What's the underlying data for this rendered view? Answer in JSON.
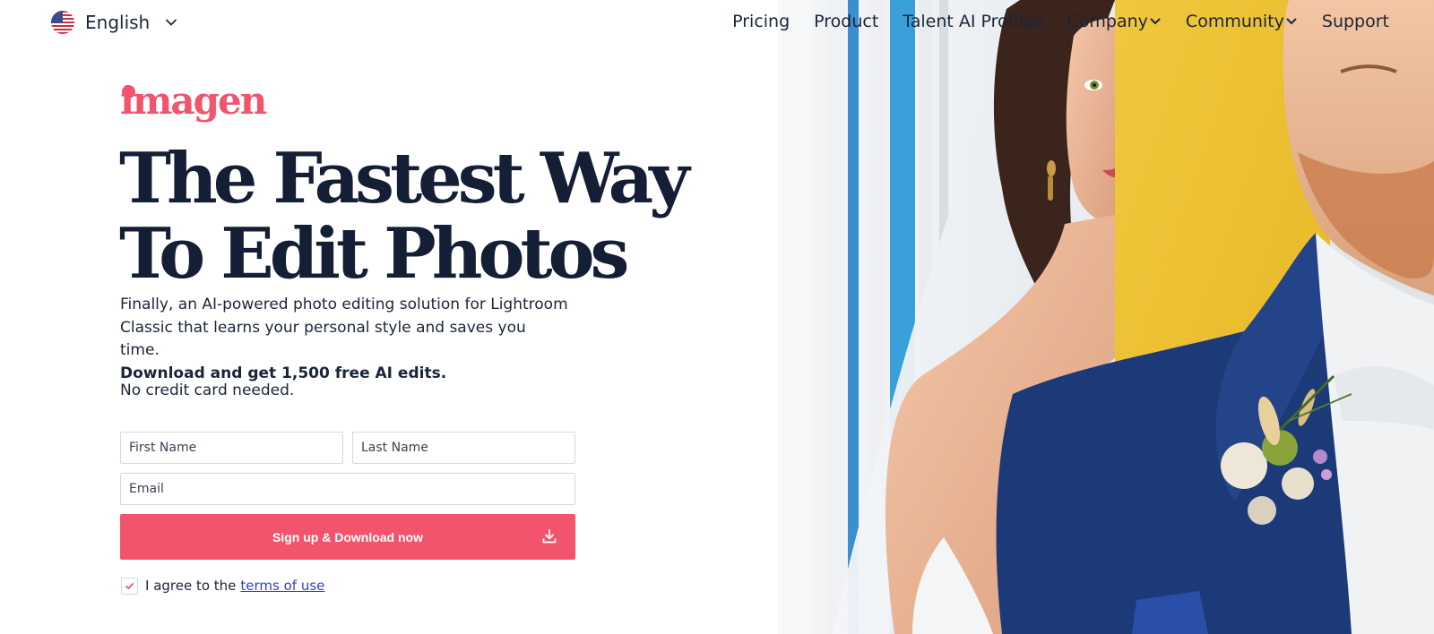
{
  "language": {
    "label": "English",
    "flag_icon": "us-flag-icon",
    "chevron_icon": "chevron-down-icon"
  },
  "nav": {
    "items": [
      {
        "label": "Pricing",
        "has_dropdown": false
      },
      {
        "label": "Product",
        "has_dropdown": false
      },
      {
        "label": "Talent AI Profiles",
        "has_dropdown": false
      },
      {
        "label": "Company",
        "has_dropdown": true
      },
      {
        "label": "Community",
        "has_dropdown": true
      },
      {
        "label": "Support",
        "has_dropdown": false
      }
    ]
  },
  "brand": {
    "logo_text": "imagen",
    "color": "#f2546d"
  },
  "hero": {
    "headline_line1": "The Fastest Way",
    "headline_line2": "To Edit Photos",
    "description": "Finally, an AI-powered photo editing solution for Lightroom Classic that learns your personal style and saves you time.",
    "description_strong": "Download and get 1,500 free AI edits.",
    "no_card": "No credit card needed."
  },
  "form": {
    "first_name_placeholder": "First Name",
    "last_name_placeholder": "Last Name",
    "email_placeholder": "Email",
    "submit_label": "Sign up & Download now",
    "submit_icon": "download-icon",
    "agree_text": "I agree to the",
    "terms_link": "terms of use",
    "agree_checked": true
  },
  "colors": {
    "accent": "#f2546d",
    "heading": "#141e35",
    "text": "#1b2538",
    "link": "#2f3fd6"
  }
}
